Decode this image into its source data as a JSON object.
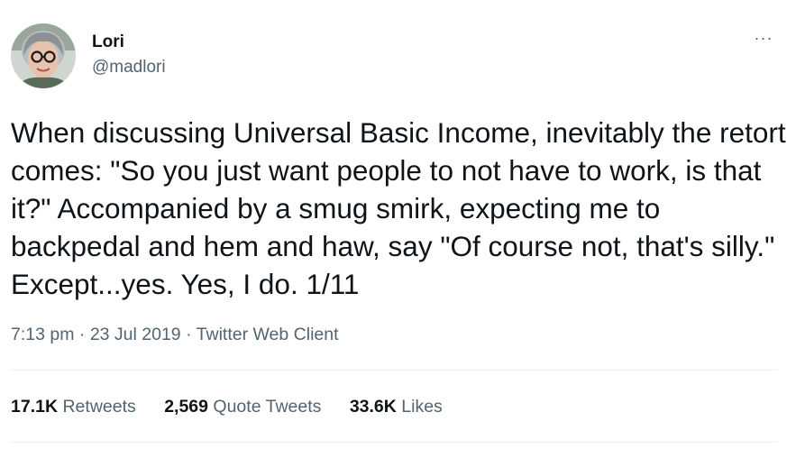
{
  "user": {
    "name": "Lori",
    "handle": "@madlori"
  },
  "tweet": {
    "text": "When discussing Universal Basic Income, inevitably the retort comes: \"So you just want people to not have to work, is that it?\" Accompanied by a smug smirk, expecting me to backpedal and hem and haw, say \"Of course not, that's silly.\" Except...yes. Yes, I do. 1/11",
    "time": "7:13 pm",
    "separator": "·",
    "date": "23 Jul 2019",
    "source": "Twitter Web Client"
  },
  "stats": {
    "retweets_count": "17.1K",
    "retweets_label": "Retweets",
    "quotes_count": "2,569",
    "quotes_label": "Quote Tweets",
    "likes_count": "33.6K",
    "likes_label": "Likes"
  },
  "menu": {
    "more_label": "···"
  },
  "colors": {
    "text": "#0f1419",
    "secondary": "#536471",
    "divider": "#eff3f4"
  },
  "icons": {
    "more": "more-icon"
  }
}
